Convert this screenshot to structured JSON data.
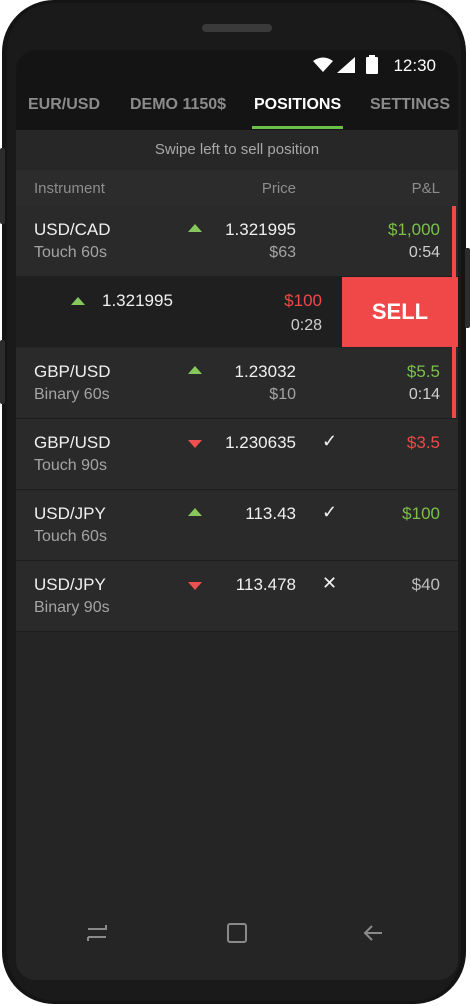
{
  "status": {
    "time": "12:30"
  },
  "tabs": [
    {
      "label": "EUR/USD"
    },
    {
      "label": "DEMO 1150$"
    },
    {
      "label": "POSITIONS"
    },
    {
      "label": "SETTINGS"
    }
  ],
  "hint": "Swipe left to sell position",
  "columns": {
    "instrument": "Instrument",
    "price": "Price",
    "pnl": "P&L"
  },
  "positions": [
    {
      "instrument": "USD/CAD",
      "type": "Touch 60s",
      "direction": "up",
      "price": "1.321995",
      "stake": "$63",
      "pnl": "$1,000",
      "pnl_status": "green",
      "time": "0:54"
    },
    {
      "instrument": "GBP/USD",
      "type": "Binary 60s",
      "direction": "up",
      "price": "1.23032",
      "stake": "$10",
      "pnl": "$5.5",
      "pnl_status": "green",
      "time": "0:14"
    },
    {
      "instrument": "GBP/USD",
      "type": "Touch 90s",
      "direction": "down",
      "price": "1.230635",
      "mark": "✓",
      "pnl": "$3.5",
      "pnl_status": "red"
    },
    {
      "instrument": "USD/JPY",
      "type": "Touch 60s",
      "direction": "up",
      "price": "113.43",
      "mark": "✓",
      "pnl": "$100",
      "pnl_status": "green"
    },
    {
      "instrument": "USD/JPY",
      "type": "Binary 90s",
      "direction": "down",
      "price": "113.478",
      "mark": "✕",
      "pnl": "$40",
      "pnl_status": "grey"
    }
  ],
  "swiped_row": {
    "direction": "up",
    "price": "1.321995",
    "pnl": "$100",
    "pnl_status": "red",
    "time": "0:28",
    "sell_label": "SELL"
  },
  "colors": {
    "accent_green": "#6cc04a",
    "up": "#86c85c",
    "down": "#f05050",
    "sell": "#f04848"
  },
  "nav": {
    "recent_icon": "recent-apps-icon",
    "home_icon": "home-icon",
    "back_icon": "back-icon"
  }
}
